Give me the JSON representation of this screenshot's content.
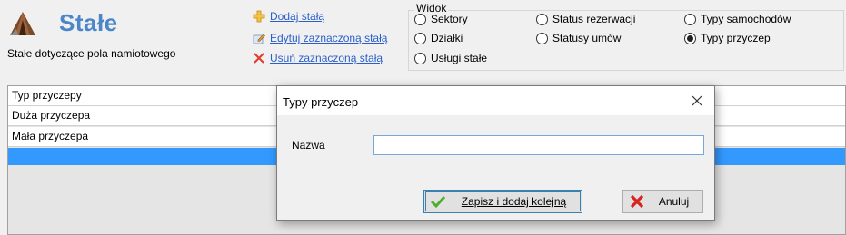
{
  "header": {
    "title": "Stałe",
    "subtitle": "Stałe dotyczące pola namiotowego"
  },
  "actions": {
    "add": "Dodaj stałą",
    "edit": "Edytuj zaznaczoną stałą",
    "remove": "Usuń zaznaczoną stałą"
  },
  "view": {
    "legend": "Widok",
    "options": [
      {
        "label": "Sektory",
        "selected": false
      },
      {
        "label": "Działki",
        "selected": false
      },
      {
        "label": "Usługi stałe",
        "selected": false
      },
      {
        "label": "Status rezerwacji",
        "selected": false
      },
      {
        "label": "Statusy umów",
        "selected": false
      },
      {
        "label": "Typy samochodów",
        "selected": false
      },
      {
        "label": "Typy przyczep",
        "selected": true
      }
    ]
  },
  "grid": {
    "header": "Typ przyczepy",
    "rows": [
      "Duża przyczepa",
      "Mała przyczepa"
    ]
  },
  "dialog": {
    "title": "Typy przyczep",
    "field_label": "Nazwa",
    "field_value": "",
    "save_label": "Zapisz i dodaj kolejną",
    "cancel_label": "Anuluj"
  }
}
